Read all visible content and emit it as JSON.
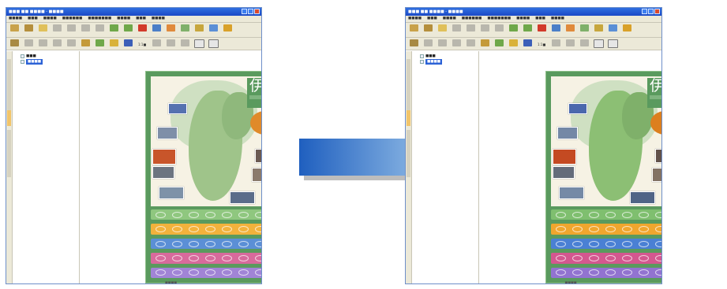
{
  "window": {
    "title": "■■■ ■■ ■■■■ - ■■■■",
    "menu": [
      "■■■■",
      "■■■",
      "■■■■",
      "■■■■■■",
      "■■■■■■■",
      "■■■■",
      "■■■",
      "■■■■"
    ],
    "zoom": "1:1■",
    "page_caption": "■■■■"
  },
  "tree": {
    "items": [
      {
        "label": "■■■"
      },
      {
        "label": "■■■■"
      }
    ]
  },
  "poster": {
    "title": "伊豆"
  },
  "colors": {
    "titlebar": "#1b49c6",
    "chrome": "#ece9d8",
    "poster_green": "#5a9a5e",
    "before_strips": [
      "#8fc77f",
      "#f2b23c",
      "#5b8fd6",
      "#d86a9c",
      "#a184d6"
    ],
    "after_strips": [
      "#7fbf6f",
      "#f0a62e",
      "#4a80d4",
      "#d4578f",
      "#9273d0"
    ],
    "arrow_start": "#1f5fbf",
    "arrow_end": "#a9cfee"
  }
}
